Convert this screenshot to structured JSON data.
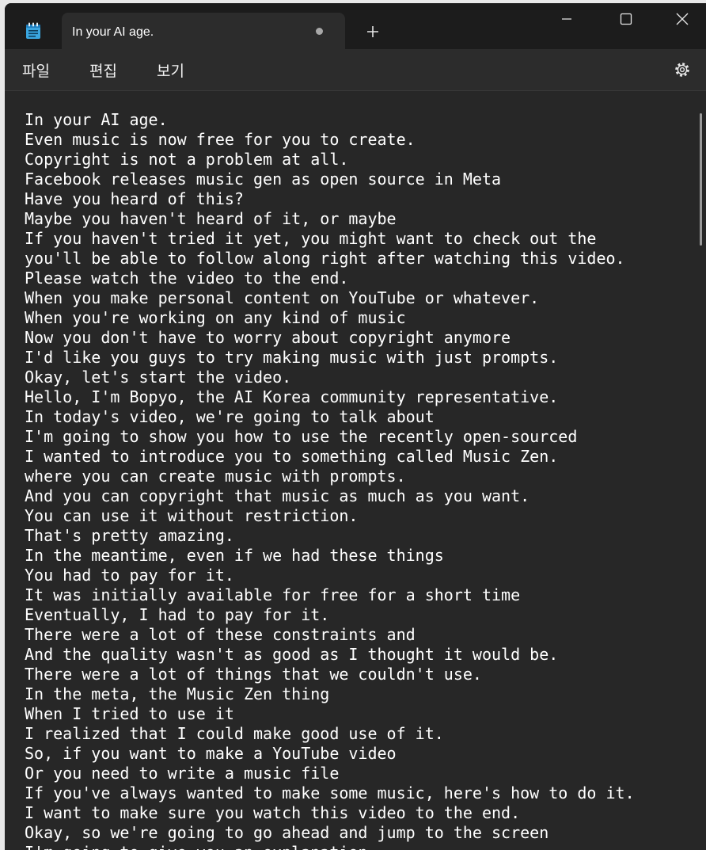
{
  "tab": {
    "title": "In your AI age.",
    "unsaved_indicator": "dot"
  },
  "icons": {
    "app": "notepad-icon",
    "new_tab": "plus-icon",
    "minimize": "minimize-icon",
    "maximize": "maximize-icon",
    "close": "close-icon",
    "settings": "gear-icon"
  },
  "menu": {
    "file": "파일",
    "edit": "편집",
    "view": "보기"
  },
  "document": {
    "lines": [
      "In your AI age.",
      "Even music is now free for you to create.",
      "Copyright is not a problem at all.",
      "Facebook releases music gen as open source in Meta",
      "Have you heard of this?",
      "Maybe you haven't heard of it, or maybe",
      "If you haven't tried it yet, you might want to check out the",
      "you'll be able to follow along right after watching this video.",
      "Please watch the video to the end.",
      "When you make personal content on YouTube or whatever.",
      "When you're working on any kind of music",
      "Now you don't have to worry about copyright anymore",
      "I'd like you guys to try making music with just prompts.",
      "Okay, let's start the video.",
      "Hello, I'm Bopyo, the AI Korea community representative.",
      "In today's video, we're going to talk about",
      "I'm going to show you how to use the recently open-sourced",
      "I wanted to introduce you to something called Music Zen.",
      "where you can create music with prompts.",
      "And you can copyright that music as much as you want.",
      "You can use it without restriction.",
      "That's pretty amazing.",
      "In the meantime, even if we had these things",
      "You had to pay for it.",
      "It was initially available for free for a short time",
      "Eventually, I had to pay for it.",
      "There were a lot of these constraints and",
      "And the quality wasn't as good as I thought it would be.",
      "There were a lot of things that we couldn't use.",
      "In the meta, the Music Zen thing",
      "When I tried to use it",
      "I realized that I could make good use of it.",
      "So, if you want to make a YouTube video",
      "Or you need to write a music file",
      "If you've always wanted to make some music, here's how to do it.",
      "I want to make sure you watch this video to the end.",
      "Okay, so we're going to go ahead and jump to the screen",
      "I'm going to give you an explanation"
    ]
  }
}
